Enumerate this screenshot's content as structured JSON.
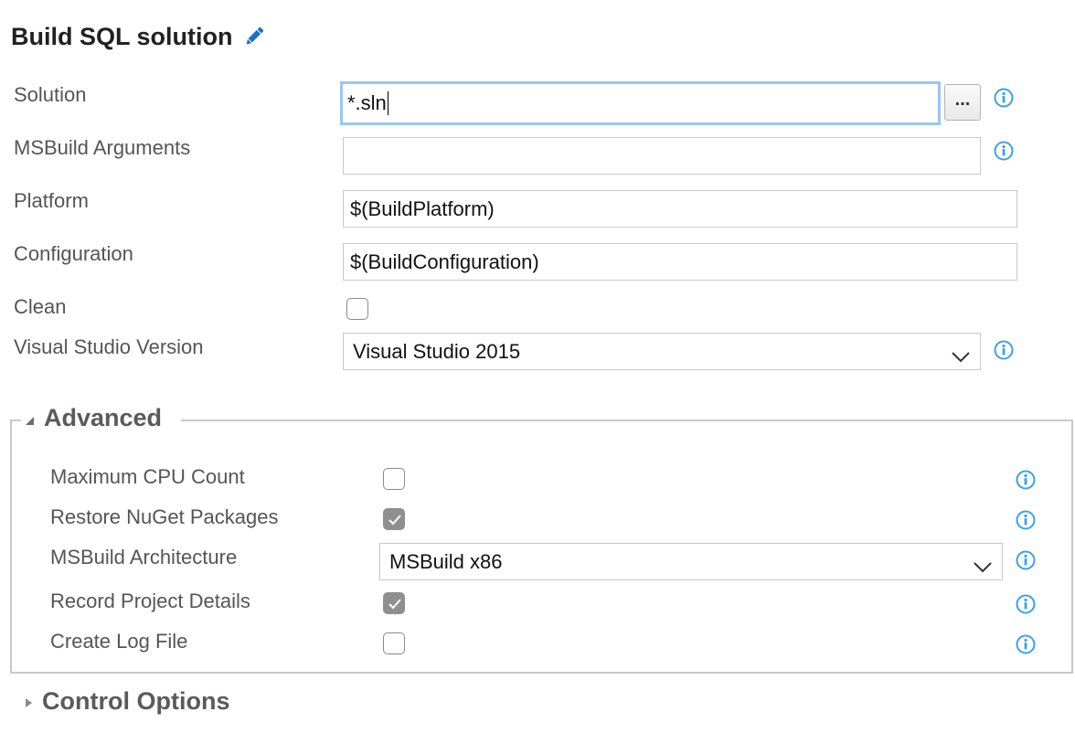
{
  "task": {
    "title": "Build SQL solution"
  },
  "fields": {
    "solution": {
      "label": "Solution",
      "value": "*.sln",
      "browse_label": "..."
    },
    "msbuild_arguments": {
      "label": "MSBuild Arguments",
      "value": ""
    },
    "platform": {
      "label": "Platform",
      "value": "$(BuildPlatform)"
    },
    "configuration": {
      "label": "Configuration",
      "value": "$(BuildConfiguration)"
    },
    "clean": {
      "label": "Clean",
      "checked": false
    },
    "visual_studio_version": {
      "label": "Visual Studio Version",
      "selected": "Visual Studio 2015"
    }
  },
  "advanced": {
    "header": "Advanced",
    "expanded": true,
    "maximum_cpu_count": {
      "label": "Maximum CPU Count",
      "checked": false
    },
    "restore_nuget_packages": {
      "label": "Restore NuGet Packages",
      "checked": true
    },
    "msbuild_architecture": {
      "label": "MSBuild Architecture",
      "selected": "MSBuild x86"
    },
    "record_project_details": {
      "label": "Record Project Details",
      "checked": true
    },
    "create_log_file": {
      "label": "Create Log File",
      "checked": false
    }
  },
  "control_options": {
    "header": "Control Options",
    "expanded": false
  },
  "colors": {
    "info_icon": "#3fa0e0",
    "pencil_icon": "#1f6fc0",
    "focus_border": "#9cc5ee",
    "checked_fill": "#8f8f8f",
    "border": "#c8c8c8"
  },
  "icons": {
    "edit": "pencil-icon",
    "info": "info-icon",
    "dropdown": "chevron-down-icon",
    "expanded": "triangle-down-icon",
    "collapsed": "triangle-right-icon"
  }
}
